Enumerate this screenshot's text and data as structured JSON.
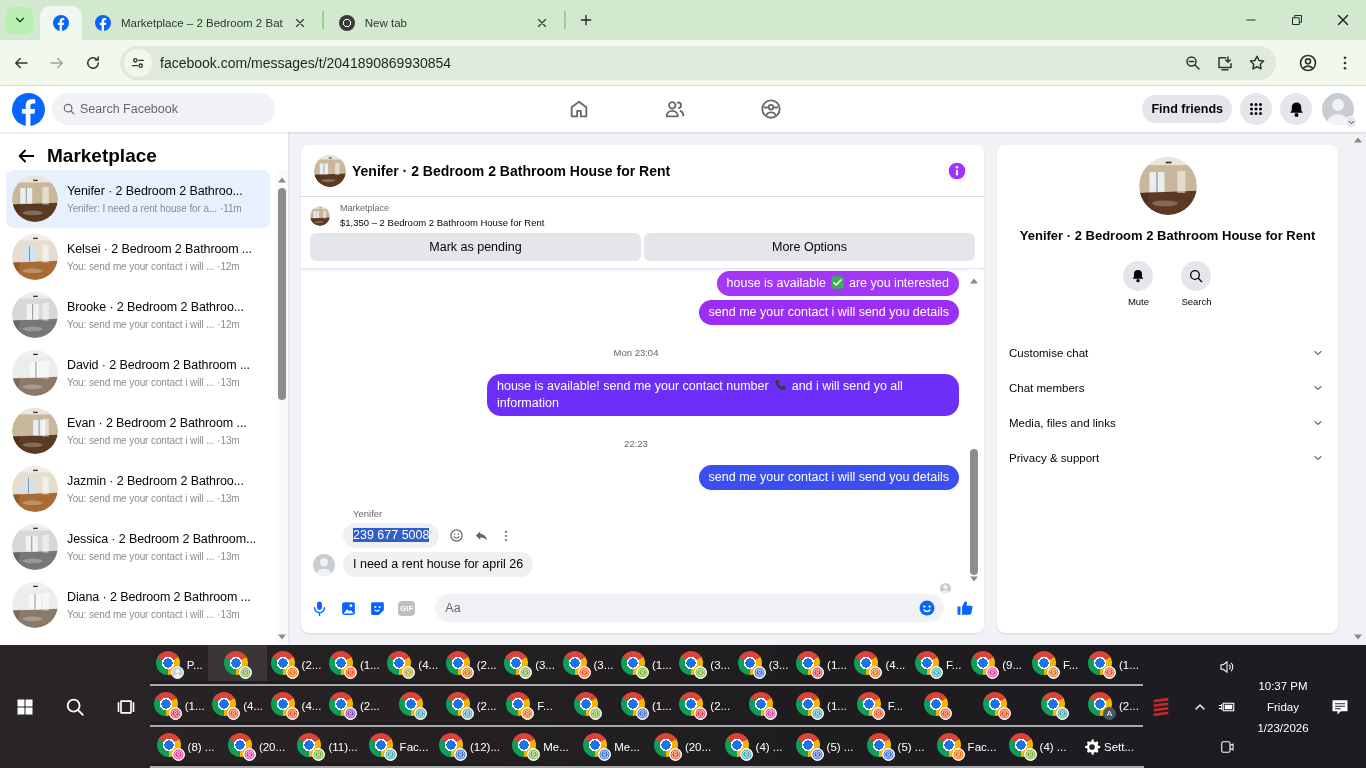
{
  "browser": {
    "tabs": [
      {
        "kind": "facebook",
        "selected": true
      },
      {
        "kind": "facebook",
        "title": "Marketplace – 2 Bedroom 2 Bat",
        "selected": false
      },
      {
        "kind": "chrome",
        "title": "New tab",
        "selected": false
      }
    ],
    "address": "facebook.com/messages/t/2041890869930854",
    "forward_disabled": true
  },
  "facebook": {
    "search_placeholder": "Search Facebook",
    "find_friends": "Find friends"
  },
  "sidebar": {
    "title": "Marketplace",
    "conversations": [
      {
        "name": "Yenifer · 2 Bedroom 2 Bathroo...",
        "preview": "Yenifer: I need a rent house for a...",
        "time": "·11m",
        "selected": true
      },
      {
        "name": "Kelsei · 2 Bedroom 2 Bathroom ...",
        "preview": "You: send me your contact i will ...",
        "time": "·12m",
        "selected": false
      },
      {
        "name": "Brooke · 2 Bedroom 2 Bathroo...",
        "preview": "You: send me your contact i will ...",
        "time": "·12m",
        "selected": false
      },
      {
        "name": "David · 2 Bedroom 2 Bathroom ...",
        "preview": "You: send me your contact i will ...",
        "time": "·13m",
        "selected": false
      },
      {
        "name": "Evan · 2 Bedroom 2 Bathroom ...",
        "preview": "You: send me your contact i will ...",
        "time": "·13m",
        "selected": false
      },
      {
        "name": "Jazmin · 2 Bedroom 2 Bathroo...",
        "preview": "You: send me your contact i will ...",
        "time": "·13m",
        "selected": false
      },
      {
        "name": "Jessica · 2 Bedroom 2 Bathroom...",
        "preview": "You: send me your contact i will ...",
        "time": "·13m",
        "selected": false
      },
      {
        "name": "Diana · 2 Bedroom 2 Bathroom ...",
        "preview": "You: send me your contact i will ...",
        "time": "·13m",
        "selected": false
      }
    ]
  },
  "chat": {
    "title": "Yenifer · 2 Bedroom 2 Bathroom House for Rent",
    "listing": {
      "label": "Marketplace",
      "title": "$1,350 – 2 Bedroom 2 Bathroom House for Rent"
    },
    "buttons": [
      "Mark as pending",
      "More Options"
    ],
    "messages": [
      {
        "kind": "sent",
        "parts": [
          {
            "kind": "text",
            "text": "house is available"
          },
          {
            "kind": "check"
          },
          {
            "kind": "text",
            "text": "are you interested"
          }
        ],
        "color": "#a336f8"
      },
      {
        "kind": "sent",
        "parts": [
          {
            "kind": "text",
            "text": "send me your contact i will send you details"
          }
        ],
        "color": "#9a2ef5"
      },
      {
        "kind": "timestamp",
        "text": "Mon 23:04"
      },
      {
        "kind": "sent",
        "parts": [
          {
            "kind": "text",
            "text": "house is available! send me your contact number"
          },
          {
            "kind": "phone"
          },
          {
            "kind": "text",
            "text": "and i will send yo all information"
          }
        ],
        "color": "#6c2ef8"
      },
      {
        "kind": "timestamp",
        "text": "22:23"
      },
      {
        "kind": "sent",
        "parts": [
          {
            "kind": "text",
            "text": "send me your contact i will send you details"
          }
        ],
        "color": "#3b4ff0"
      },
      {
        "kind": "sender",
        "text": "Yenifer"
      },
      {
        "kind": "received",
        "text": "239 677 5008",
        "text_selected": true,
        "actions": true,
        "avatar": false
      },
      {
        "kind": "received",
        "text": "I need a rent house for april 26",
        "text_selected": false,
        "actions": false,
        "avatar": true
      }
    ],
    "seen": true,
    "composer": {
      "placeholder": "Aa",
      "gif_label": "GIF"
    }
  },
  "details": {
    "title": "Yenifer · 2 Bedroom 2 Bathroom House for Rent",
    "actions": [
      {
        "kind": "bell",
        "label": "Mute"
      },
      {
        "kind": "search",
        "label": "Search"
      }
    ],
    "sections": [
      {
        "label": "Customise chat",
        "expanded": false
      },
      {
        "label": "Chat members",
        "expanded": false
      },
      {
        "label": "Media, files and links",
        "expanded": false
      },
      {
        "label": "Privacy & support",
        "expanded": false
      }
    ]
  },
  "taskbar": {
    "rows": [
      {
        "buttons": [
          {
            "kind": "photo_badge",
            "label": "P...",
            "selected": false
          },
          {
            "kind": "profile_badge",
            "color": "#7cb342",
            "selected": true
          },
          {
            "kind": "profile_badge",
            "label": "(2...",
            "color": "#e8710a",
            "selected": false
          },
          {
            "kind": "profile_badge",
            "label": "(1...",
            "color": "#f4511e",
            "selected": false
          },
          {
            "kind": "profile_badge",
            "label": "(4...",
            "color": "#b5a642",
            "selected": false
          },
          {
            "kind": "profile_badge",
            "label": "(2...",
            "color": "#e8710a",
            "selected": false
          },
          {
            "kind": "profile_badge",
            "label": "(3...",
            "color": "#7cb342",
            "selected": false
          },
          {
            "kind": "profile_badge",
            "label": "(3...",
            "color": "#f4511e",
            "selected": false
          },
          {
            "kind": "profile_badge",
            "label": "(1...",
            "color": "#7cb342",
            "selected": false
          },
          {
            "kind": "profile_badge",
            "label": "(3...",
            "color": "#7cb342",
            "selected": false
          },
          {
            "kind": "profile_badge",
            "label": "(3...",
            "color": "#3f6fd8",
            "selected": false
          },
          {
            "kind": "profile_badge",
            "label": "(1...",
            "color": "#e53950",
            "selected": false
          },
          {
            "kind": "profile_badge",
            "label": "(4...",
            "color": "#e8710a",
            "selected": false
          },
          {
            "kind": "profile_badge",
            "label": "F...",
            "color": "#4aa8b0",
            "selected": false
          },
          {
            "kind": "profile_badge",
            "label": "(9...",
            "color": "#e0449a",
            "selected": false
          },
          {
            "kind": "profile_badge",
            "label": "F...",
            "color": "#e8710a",
            "selected": false
          },
          {
            "kind": "profile_badge",
            "label": "(1...",
            "color": "#f4511e",
            "selected": false
          }
        ]
      },
      {
        "buttons": [
          {
            "kind": "profile_badge",
            "label": "(1...",
            "color": "#e53950",
            "selected": false
          },
          {
            "kind": "profile_badge",
            "label": "(4...",
            "color": "#f4511e",
            "selected": false
          },
          {
            "kind": "profile_badge",
            "label": "(4...",
            "color": "#f4511e",
            "selected": false
          },
          {
            "kind": "profile_badge",
            "label": "(2...",
            "color": "#8e44c9",
            "selected": false
          },
          {
            "kind": "profile_badge",
            "color": "#4aa8b0",
            "selected": false
          },
          {
            "kind": "profile_badge",
            "label": "(2...",
            "color": "#4aa8b0",
            "selected": false
          },
          {
            "kind": "profile_badge",
            "label": "F...",
            "color": "#e8710a",
            "selected": false
          },
          {
            "kind": "profile_badge",
            "color": "#7cb342",
            "selected": false
          },
          {
            "kind": "profile_badge",
            "label": "(1...",
            "color": "#3f6fd8",
            "selected": false
          },
          {
            "kind": "profile_badge",
            "label": "(2...",
            "color": "#e53950",
            "selected": false
          },
          {
            "kind": "profile_badge",
            "color": "#e0449a",
            "selected": false
          },
          {
            "kind": "profile_badge",
            "label": "(1...",
            "color": "#4aa8b0",
            "selected": false
          },
          {
            "kind": "profile_badge",
            "label": "F...",
            "color": "#f4511e",
            "selected": false
          },
          {
            "kind": "profile_badge",
            "color": "#f4511e",
            "selected": false
          },
          {
            "kind": "profile_badge",
            "color": "#f4511e",
            "selected": false
          },
          {
            "kind": "profile_badge",
            "color": "#4aa8b0",
            "selected": false
          },
          {
            "kind": "letter_badge",
            "label": "(2...",
            "letter": "A",
            "color": "#455a64",
            "selected": false
          }
        ]
      },
      {
        "buttons": [
          {
            "kind": "profile_badge",
            "label": "(8) ...",
            "color": "#e0449a",
            "selected": false
          },
          {
            "kind": "profile_badge",
            "label": "(20...",
            "color": "#e0449a",
            "selected": false
          },
          {
            "kind": "profile_badge",
            "label": "(11)...",
            "color": "#7cb342",
            "selected": false
          },
          {
            "kind": "profile_badge",
            "label": "Fac...",
            "color": "#4aa8b0",
            "selected": false
          },
          {
            "kind": "profile_badge",
            "label": "(12)...",
            "color": "#3f6fd8",
            "selected": false
          },
          {
            "kind": "profile_badge",
            "label": "Me...",
            "color": "#7cb342",
            "selected": false
          },
          {
            "kind": "profile_badge",
            "label": "Me...",
            "color": "#3f6fd8",
            "selected": false
          },
          {
            "kind": "profile_badge",
            "label": "(20...",
            "color": "#f4511e",
            "selected": false
          },
          {
            "kind": "profile_badge",
            "label": "(4) ...",
            "color": "#4aa8b0",
            "selected": false
          },
          {
            "kind": "profile_badge",
            "label": "(5) ...",
            "color": "#3f6fd8",
            "selected": false
          },
          {
            "kind": "profile_badge",
            "label": "(5) ...",
            "color": "#3f6fd8",
            "selected": false
          },
          {
            "kind": "profile_badge",
            "label": "Fac...",
            "color": "#e8710a",
            "selected": false
          },
          {
            "kind": "profile_badge",
            "label": "(4) ...",
            "color": "#7cb342",
            "selected": false
          },
          {
            "kind": "settings",
            "label": "Sett...",
            "selected": false
          }
        ]
      }
    ],
    "clock": {
      "time": "10:37 PM",
      "day": "Friday",
      "date": "1/23/2026"
    }
  }
}
